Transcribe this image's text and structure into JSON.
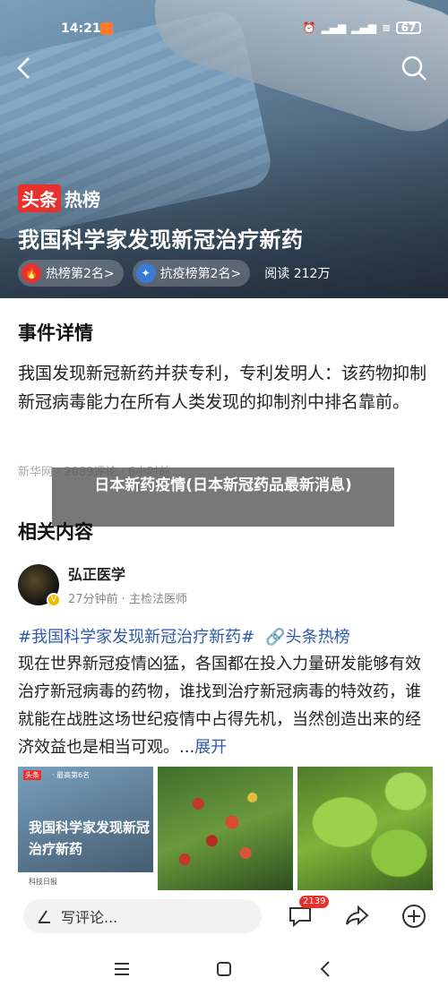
{
  "status_bar": {
    "time": "14:21",
    "battery": "67"
  },
  "hero": {
    "brand_part1": "头条",
    "brand_part2": "热榜",
    "title": "我国科学家发现新冠治疗新药",
    "chips": [
      {
        "label": "热榜第2名>",
        "icon": "fire-icon"
      },
      {
        "label": "抗疫榜第2名>",
        "icon": "shield-virus-icon"
      }
    ],
    "read_label": "阅读 212万"
  },
  "event": {
    "heading": "事件详情",
    "body": "我国发现新冠新药并获专利，专利发明人：该药物抑制新冠病毒能力在所有人类发现的抑制剂中排名靠前。",
    "source_meta": "新华网 · 2089评论 · 6小时前"
  },
  "overlay": {
    "text": "日本新药疫情(日本新冠药品最新消息)"
  },
  "related": {
    "heading": "相关内容",
    "author": {
      "name": "弘正医学",
      "meta": "27分钟前 · 主检法医师"
    },
    "tag1": "#我国科学家发现新冠治疗新药#",
    "tag2": "头条热榜",
    "body": "现在世界新冠疫情凶猛，各国都在投入力量研发能够有效治疗新冠病毒的药物，谁找到治疗新冠病毒的特效药，谁就能在战胜这场世纪疫情中占得先机，当然创造出来的经济效益也是相当可观。...",
    "expand": "展开",
    "thumb1": {
      "label": "头条",
      "sub": "· 最高第6名",
      "title": "我国科学家发现新冠治疗新药",
      "foot": "科技日报"
    }
  },
  "action_bar": {
    "comment_placeholder": "写评论...",
    "comment_count": "2139"
  },
  "colors": {
    "brand_red": "#e8302c",
    "link_blue": "#2e5aa8"
  }
}
